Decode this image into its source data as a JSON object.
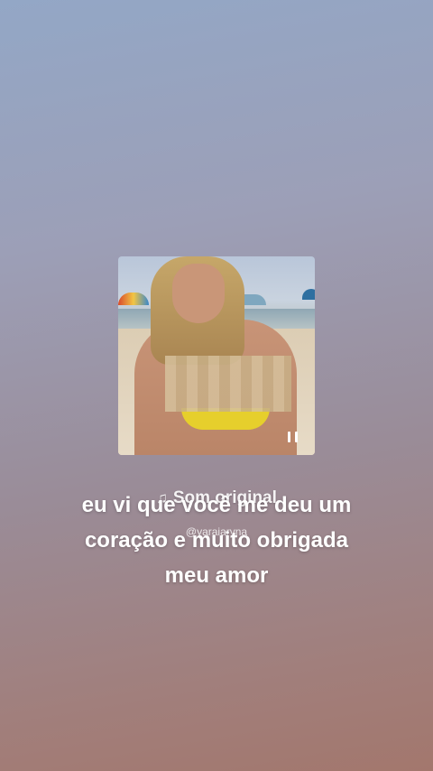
{
  "story": {
    "music": {
      "icon": "music-note-icon",
      "title": "Som original",
      "username": "@yaraiaryna"
    },
    "caption": {
      "line1": "eu vi que você me deu um",
      "line2": "coração e muito obrigada",
      "line3": "meu amor"
    },
    "player": {
      "state_icon": "pause-icon"
    }
  }
}
